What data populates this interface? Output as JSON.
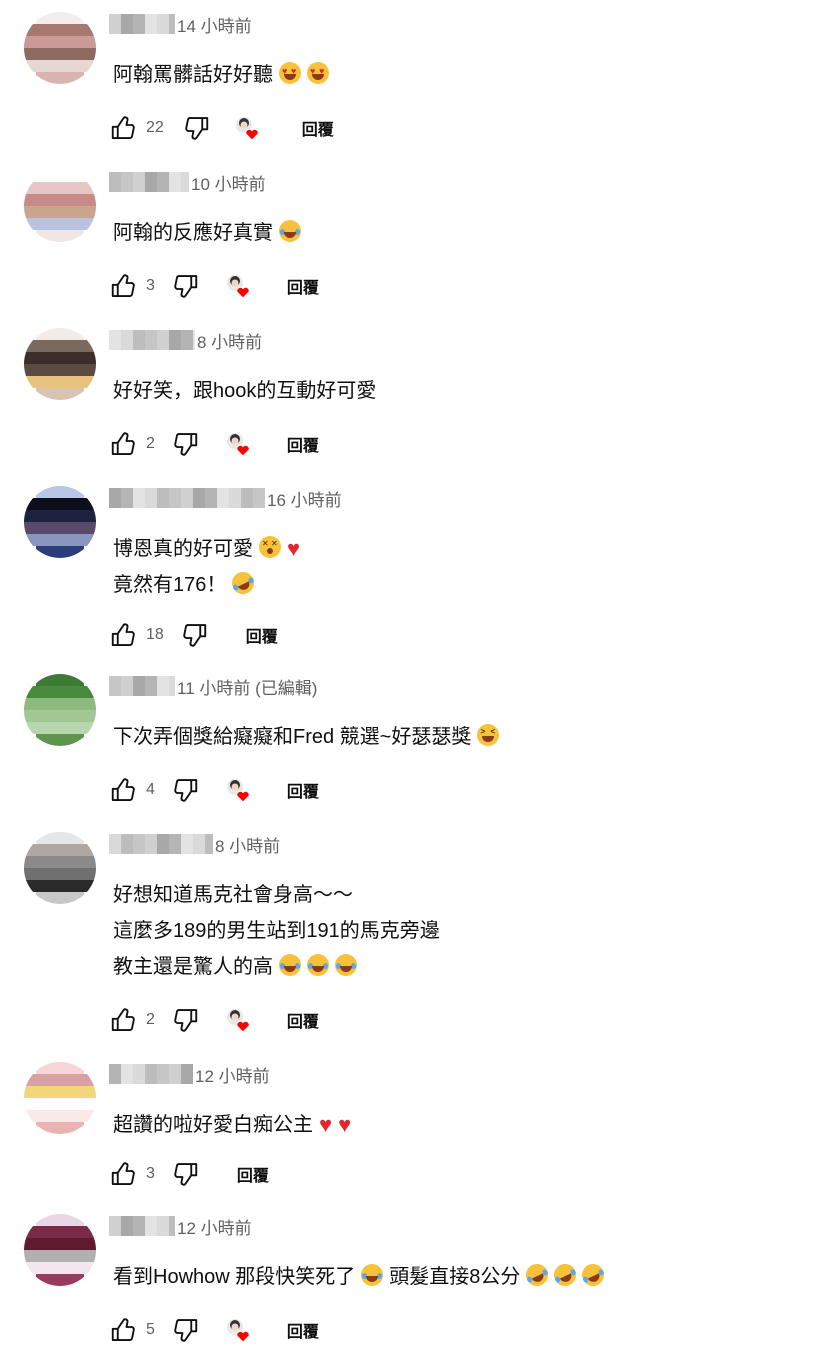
{
  "comments": [
    {
      "time": "14 小時前",
      "lines": [
        "阿翰罵髒話好好聽"
      ],
      "likes": "22",
      "reply": "回覆"
    },
    {
      "time": "10 小時前",
      "lines": [
        "阿翰的反應好真實"
      ],
      "likes": "3",
      "reply": "回覆"
    },
    {
      "time": "8 小時前",
      "lines": [
        "好好笑，跟hook的互動好可愛"
      ],
      "likes": "2",
      "reply": "回覆"
    },
    {
      "time": "16 小時前",
      "lines": [
        "博恩真的好可愛",
        "竟然有176！"
      ],
      "likes": "18",
      "reply": "回覆"
    },
    {
      "time": "11 小時前 (已編輯)",
      "lines": [
        "下次弄個獎給癡癡和Fred 競選~好瑟瑟獎"
      ],
      "likes": "4",
      "reply": "回覆"
    },
    {
      "time": "8 小時前",
      "lines": [
        "好想知道馬克社會身高～～",
        "這麼多189的男生站到191的馬克旁邊",
        "教主還是驚人的高"
      ],
      "likes": "2",
      "reply": "回覆"
    },
    {
      "time": "12 小時前",
      "lines": [
        "超讚的啦好愛白痴公主"
      ],
      "likes": "3",
      "reply": "回覆"
    },
    {
      "time": "12 小時前",
      "lines": [
        "看到Howhow 那段快笑死了",
        "頭髮直接8公分"
      ],
      "likes": "5",
      "reply": "回覆"
    }
  ],
  "icons": {
    "like": "thumbs-up-icon",
    "dislike": "thumbs-down-icon",
    "creator_heart": "creator-heart-badge-icon"
  },
  "colors": {
    "text": "#0f0f0f",
    "meta": "#606060",
    "heart": "#e0262e"
  }
}
